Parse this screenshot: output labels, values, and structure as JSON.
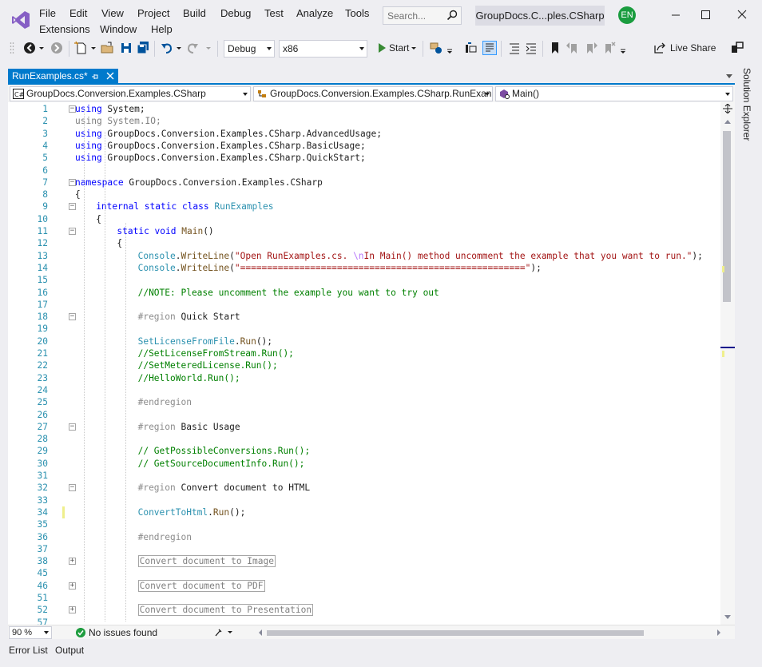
{
  "menu": {
    "items": [
      "File",
      "Edit",
      "View",
      "Project",
      "Build",
      "Debug",
      "Test",
      "Analyze",
      "Tools",
      "Extensions",
      "Window",
      "Help"
    ]
  },
  "search": {
    "placeholder": "Search..."
  },
  "solution_name": "GroupDocs.C...ples.CSharp",
  "user_initials": "EN",
  "toolbar": {
    "configuration": "Debug",
    "platform": "x86",
    "start_label": "Start",
    "live_share_label": "Live Share"
  },
  "doc_tab": {
    "title": "RunExamples.cs*"
  },
  "navbar": {
    "project": "GroupDocs.Conversion.Examples.CSharp",
    "type": "GroupDocs.Conversion.Examples.CSharp.RunExan",
    "member": "Main()"
  },
  "code": {
    "line_numbers": [
      "1",
      "2",
      "3",
      "4",
      "5",
      "6",
      "7",
      "8",
      "9",
      "10",
      "11",
      "12",
      "13",
      "14",
      "15",
      "16",
      "17",
      "18",
      "19",
      "20",
      "21",
      "22",
      "23",
      "24",
      "25",
      "26",
      "27",
      "28",
      "29",
      "30",
      "31",
      "32",
      "33",
      "34",
      "35",
      "36",
      "37",
      "38",
      "45",
      "46",
      "51",
      "52",
      "57"
    ],
    "lines": [
      "using System;",
      "using System.IO;",
      "using GroupDocs.Conversion.Examples.CSharp.AdvancedUsage;",
      "using GroupDocs.Conversion.Examples.CSharp.BasicUsage;",
      "using GroupDocs.Conversion.Examples.CSharp.QuickStart;",
      "",
      "namespace GroupDocs.Conversion.Examples.CSharp",
      "{",
      "internal static class RunExamples",
      "{",
      "static void Main()",
      "{",
      "Console.WriteLine(\"Open RunExamples.cs. \\nIn Main() method uncomment the example that you want to run.\");",
      "Console.WriteLine(\"=====================================================\");",
      "",
      "//NOTE: Please uncomment the example you want to try out",
      "",
      "#region Quick Start",
      "",
      "SetLicenseFromFile.Run();",
      "//SetLicenseFromStream.Run();",
      "//SetMeteredLicense.Run();",
      "//HelloWorld.Run();",
      "",
      "#endregion",
      "",
      "#region Basic Usage",
      "",
      "// GetPossibleConversions.Run();",
      "// GetSourceDocumentInfo.Run();",
      "",
      "#region Convert document to HTML",
      "",
      "ConvertToHtml.Run();",
      "",
      "#endregion",
      "",
      "Convert document to Image",
      "",
      "Convert document to PDF",
      "",
      "Convert document to Presentation",
      ""
    ]
  },
  "status": {
    "zoom": "90 %",
    "issues": "No issues found"
  },
  "bottom_tabs": [
    "Error List",
    "Output"
  ],
  "side_panel": {
    "label": "Solution Explorer"
  },
  "colors": {
    "accent": "#007acc",
    "keyword": "#0000ff",
    "type": "#2b91af",
    "string": "#a31515",
    "comment": "#008000",
    "change_marker": "#efef8c",
    "avatar": "#1a9c3f"
  }
}
